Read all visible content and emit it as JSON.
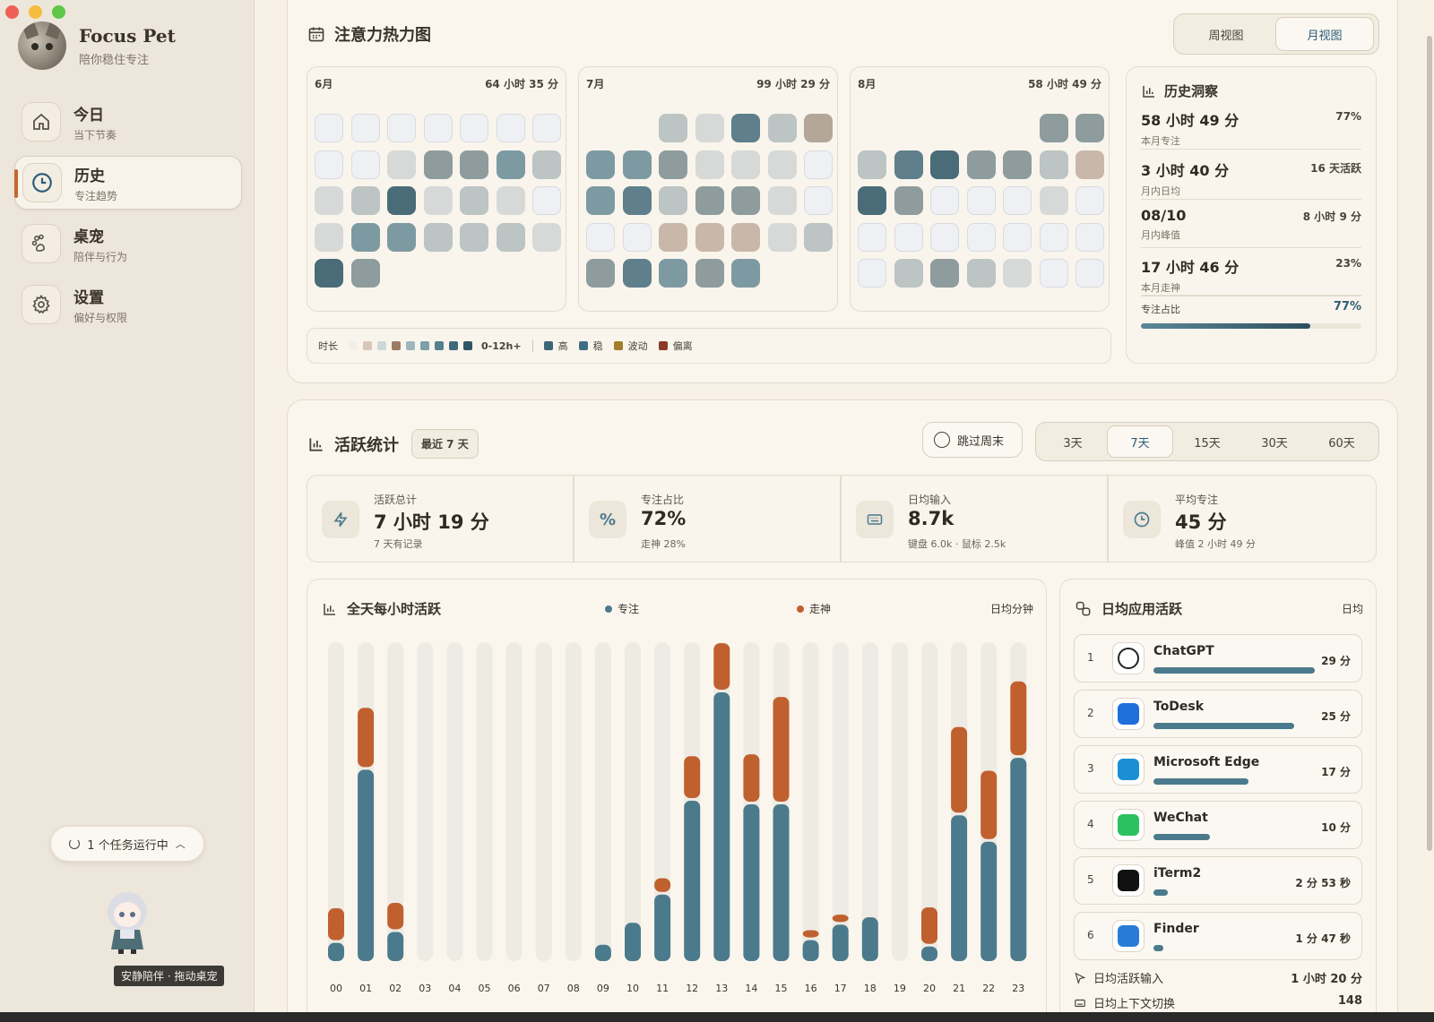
{
  "app": {
    "title": "Focus Pet",
    "subtitle": "陪你稳住专注"
  },
  "nav": [
    {
      "label": "今日",
      "sub": "当下节奏"
    },
    {
      "label": "历史",
      "sub": "专注趋势"
    },
    {
      "label": "桌宠",
      "sub": "陪伴与行为"
    },
    {
      "label": "设置",
      "sub": "偏好与权限"
    }
  ],
  "task_pill": "1 个任务运行中",
  "pet_caption": "安静陪伴 · 拖动桌宠",
  "heatmap": {
    "title": "注意力热力图",
    "view_toggle": [
      "周视图",
      "月视图"
    ],
    "months": [
      {
        "name": "6月",
        "total": "64 小时 35 分"
      },
      {
        "name": "7月",
        "total": "99 小时 29 分"
      },
      {
        "name": "8月",
        "total": "58 小时 49 分"
      }
    ],
    "legend": {
      "label": "时长",
      "range": "0-12h+",
      "states": [
        "高",
        "稳",
        "波动",
        "偏离"
      ]
    }
  },
  "insights": {
    "title": "历史洞察",
    "rows": [
      {
        "main": "58 小时 49 分",
        "sub": "本月专注",
        "right": "77%"
      },
      {
        "main": "3 小时 40 分",
        "sub": "月内日均",
        "right": "16 天活跃"
      },
      {
        "main": "08/10",
        "sub": "月内峰值",
        "right": "8 小时 9 分"
      },
      {
        "main": "17 小时 46 分",
        "sub": "本月走神",
        "right": "23%"
      }
    ],
    "ratio_label": "专注占比",
    "ratio_value": "77%",
    "ratio_fraction": 0.77
  },
  "activity": {
    "title": "活跃统计",
    "range_badge": "最近 7 天",
    "skip_weekend": "跳过周末",
    "ranges": [
      "3天",
      "7天",
      "15天",
      "30天",
      "60天"
    ],
    "stats": [
      {
        "label": "活跃总计",
        "value": "7 小时 19 分",
        "sub": "7 天有记录"
      },
      {
        "label": "专注占比",
        "value": "72%",
        "sub": "走神 28%"
      },
      {
        "label": "日均输入",
        "value": "8.7k",
        "sub": "键盘 6.0k · 鼠标 2.5k"
      },
      {
        "label": "平均专注",
        "value": "45 分",
        "sub": "峰值 2 小时 49 分"
      }
    ]
  },
  "hourly": {
    "title": "全天每小时活跃",
    "legend_focus": "专注",
    "legend_distract": "走神",
    "unit": "日均分钟"
  },
  "apps": {
    "title": "日均应用活跃",
    "unit": "日均",
    "items": [
      {
        "rank": "1",
        "name": "ChatGPT",
        "time": "29 分",
        "fraction": 1.0
      },
      {
        "rank": "2",
        "name": "ToDesk",
        "time": "25 分",
        "fraction": 0.87
      },
      {
        "rank": "3",
        "name": "Microsoft Edge",
        "time": "17 分",
        "fraction": 0.59
      },
      {
        "rank": "4",
        "name": "WeChat",
        "time": "10 分",
        "fraction": 0.35
      },
      {
        "rank": "5",
        "name": "iTerm2",
        "time": "2 分 53 秒",
        "fraction": 0.09
      },
      {
        "rank": "6",
        "name": "Finder",
        "time": "1 分 47 秒",
        "fraction": 0.06
      }
    ],
    "footer": [
      {
        "label": "日均活跃输入",
        "value": "1 小时 20 分"
      },
      {
        "label": "日均上下文切换",
        "value": "148"
      }
    ]
  },
  "colors": {
    "accent": "#c6652f",
    "focus": "#4b7a8c",
    "distract": "#c0602e",
    "track": "#eeebe4"
  },
  "chart_data": {
    "type": "bar",
    "title": "全天每小时活跃",
    "ylabel": "日均分钟",
    "categories": [
      "00",
      "01",
      "02",
      "03",
      "04",
      "05",
      "06",
      "07",
      "08",
      "09",
      "10",
      "11",
      "12",
      "13",
      "14",
      "15",
      "16",
      "17",
      "18",
      "19",
      "20",
      "21",
      "22",
      "23"
    ],
    "series": [
      {
        "name": "专注",
        "values": [
          2.0,
          21.0,
          3.2,
          0,
          0,
          0,
          0,
          0,
          0,
          1.8,
          4.2,
          7.3,
          17.6,
          29.5,
          17.2,
          17.2,
          2.3,
          4.0,
          4.8,
          0,
          1.6,
          16.0,
          13.1,
          22.3
        ]
      },
      {
        "name": "走神",
        "values": [
          3.5,
          6.5,
          2.9,
          0,
          0,
          0,
          0,
          0,
          0,
          0,
          0,
          1.5,
          4.6,
          5.1,
          5.2,
          11.5,
          0.8,
          0.8,
          0,
          0,
          4.0,
          9.4,
          7.5,
          8.1
        ]
      }
    ],
    "ylim": [
      0,
      35
    ],
    "grid": false,
    "legend": "top"
  }
}
